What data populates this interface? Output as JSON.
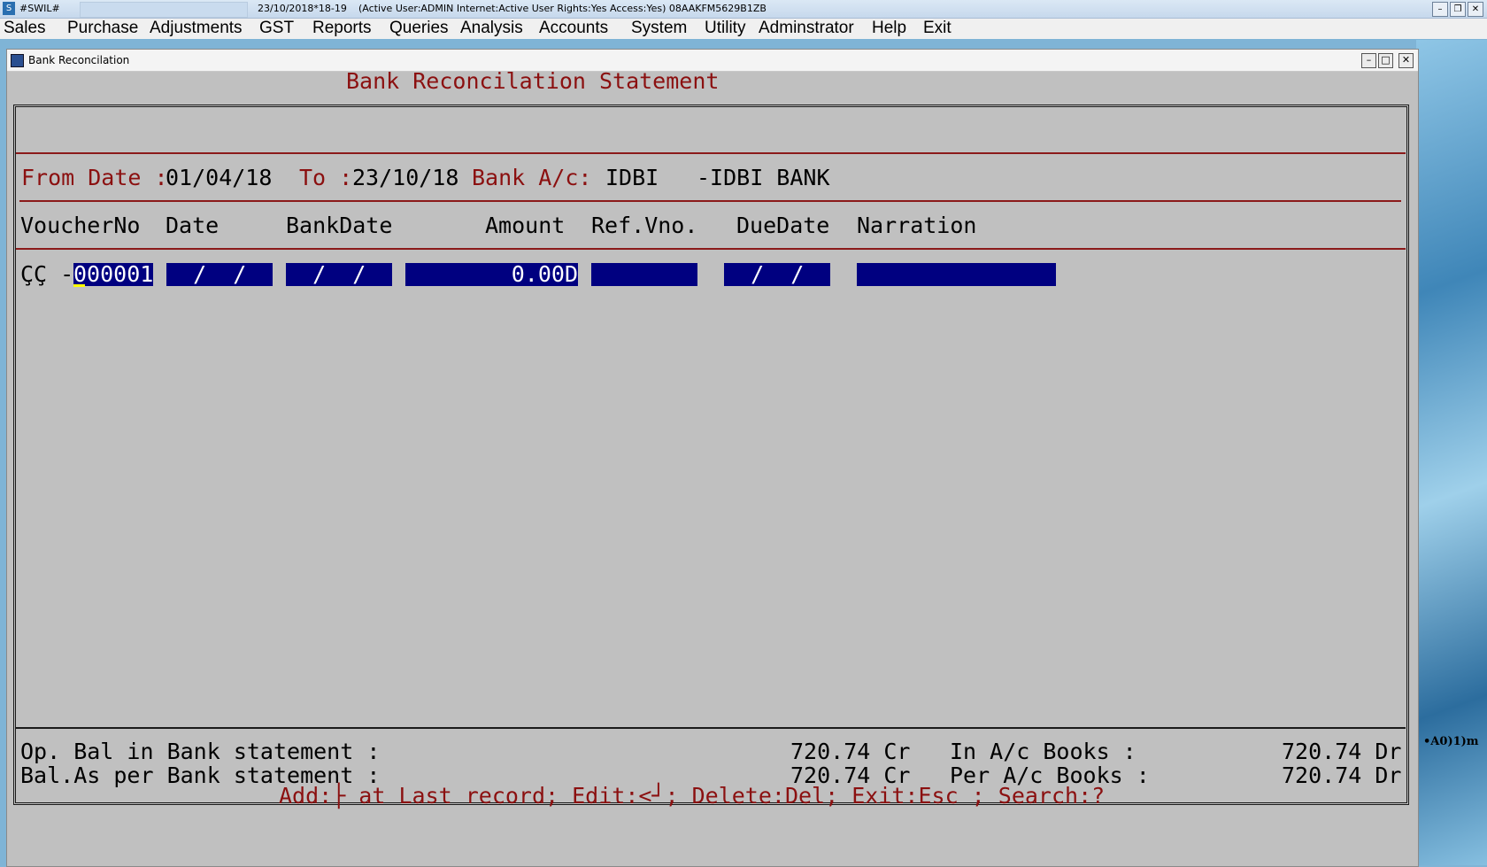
{
  "window": {
    "app_title": "#SWIL#",
    "date_fy": "23/10/2018*18-19",
    "status": "(Active User:ADMIN Internet:Active  User Rights:Yes Access:Yes) 08AAKFM5629B1ZB",
    "btn_min": "–",
    "btn_restore": "❐",
    "btn_close": "✕"
  },
  "menu": [
    "Sales",
    "Purchase",
    "Adjustments",
    "GST",
    "Reports",
    "Queries",
    "Analysis",
    "Accounts",
    "System",
    "Utility",
    "Adminstrator",
    "Help",
    "Exit"
  ],
  "child": {
    "title": "Bank Reconcilation",
    "btn_min": "–",
    "btn_max": "□",
    "btn_close": "✕"
  },
  "form": {
    "heading": "Bank Reconcilation Statement",
    "from_label": "From Date :",
    "from_value": "01/04/18",
    "to_label": "To :",
    "to_value": "23/10/18",
    "bank_label": "Bank A/c:",
    "bank_code": "IDBI",
    "bank_name": "-IDBI BANK"
  },
  "columns": {
    "voucher": "VoucherNo",
    "date": "Date",
    "bankdate": "BankDate",
    "amount": "Amount",
    "refvno": "Ref.Vno.",
    "duedate": "DueDate",
    "narration": "Narration"
  },
  "row": {
    "prefix": "ÇÇ -",
    "voucher": "000001",
    "date": "  /  /",
    "bankdate": "  /  /",
    "amount": "0.00D",
    "refvno": "",
    "duedate": "  /  /",
    "narration": ""
  },
  "totals": {
    "op_bal_label": "Op. Bal in Bank statement :",
    "op_bal_value": "720.74 Cr",
    "in_books_label": "In A/c Books :",
    "in_books_value": "720.74 Dr",
    "bal_bank_label": "Bal.As per Bank statement :",
    "bal_bank_value": "720.74 Cr",
    "per_books_label": "Per A/c Books :",
    "per_books_value": "720.74 Dr"
  },
  "hint": "Add:├ at Last record; Edit:<┘; Delete:Del; Exit:Esc ; Search:?",
  "desktop_fragment": "•A0)1)m"
}
